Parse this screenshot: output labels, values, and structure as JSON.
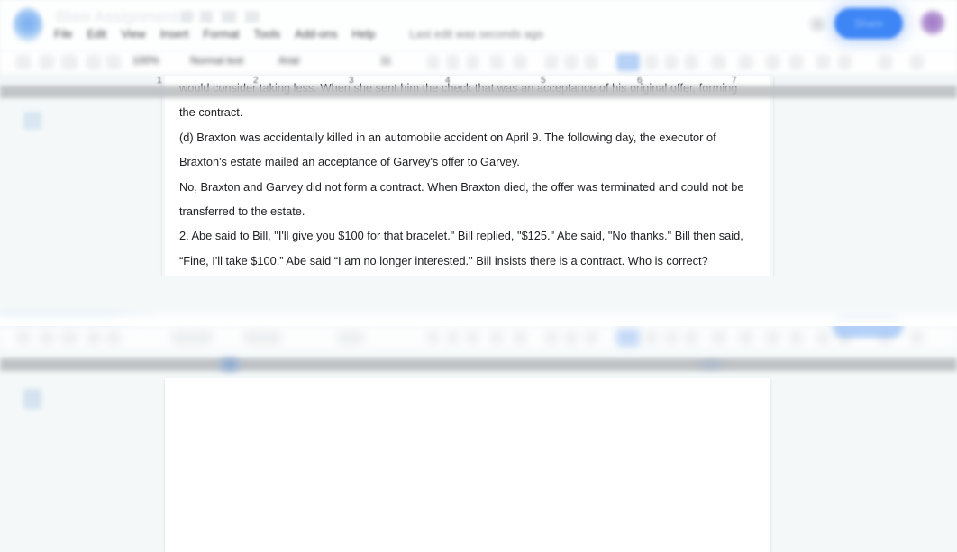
{
  "app": {
    "name": "Google Docs",
    "logo_icon": "docs-logo-icon",
    "doc_title": "Blaw Assignment D",
    "last_edit": "Last edit was seconds ago"
  },
  "header": {
    "menu": [
      {
        "label": "File"
      },
      {
        "label": "Edit"
      },
      {
        "label": "View"
      },
      {
        "label": "Insert"
      },
      {
        "label": "Format"
      },
      {
        "label": "Tools"
      },
      {
        "label": "Add-ons"
      },
      {
        "label": "Help"
      }
    ],
    "comment_icon": "comment-icon",
    "share_label": "Share",
    "share_color": "#2f7df6",
    "avatar_icon": "user-avatar-icon",
    "avatar_color": "#9b71c4"
  },
  "toolbar": {
    "zoom": "100%",
    "paragraph_style": "Normal text",
    "font_family": "Arial",
    "font_size": "11",
    "icons": [
      "undo-icon",
      "redo-icon",
      "print-icon",
      "spelling-check-icon",
      "paint-format-icon",
      "bold-icon",
      "italic-icon",
      "underline-icon",
      "text-color-icon",
      "highlight-color-icon",
      "insert-link-icon",
      "insert-comment-icon",
      "insert-image-icon",
      "align-left-icon",
      "line-spacing-icon",
      "checklist-icon",
      "bulleted-list-icon",
      "numbered-list-icon",
      "decrease-indent-icon",
      "increase-indent-icon",
      "clear-formatting-icon",
      "editing-mode-icon",
      "hide-menus-icon"
    ],
    "active_icon": "align-left-icon"
  },
  "ruler": {
    "marks": [
      "1",
      "2",
      "3",
      "4",
      "5",
      "6",
      "7"
    ]
  },
  "document": {
    "paragraphs": [
      {
        "indent": true,
        "text": "would consider taking less. When she sent him the check that was an acceptance of his original offer, forming the contract."
      },
      {
        "indent": true,
        "text": "(d) Braxton was accidentally killed in an automobile accident on April 9. The following day, the executor of Braxton's estate mailed an acceptance of Garvey's offer to Garvey."
      },
      {
        "indent": true,
        "text": "No, Braxton and Garvey did not form a contract. When Braxton died, the offer was terminated and could not be transferred to the estate."
      },
      {
        "indent": false,
        "text": "2. Abe said to Bill, \"I'll give you $100 for that bracelet.\" Bill replied, \"$125.\" Abe said, \"No thanks.\" Bill then said, “Fine, I'll take $100.” Abe said “I am no longer interested.\" Bill insists there is a contract. Who is correct?"
      }
    ]
  },
  "colors": {
    "page_background": "#ffffff",
    "canvas_background": "#f4f8f9",
    "ruler_band": "#bfc2c4",
    "text": "#202124",
    "menu_text": "#3c4043",
    "muted_text": "#80868b"
  }
}
